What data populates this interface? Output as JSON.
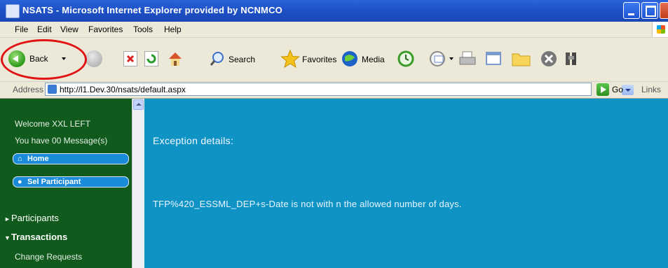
{
  "window": {
    "title": "NSATS - Microsoft Internet Explorer provided by NCNMCO"
  },
  "menu": {
    "items": [
      "File",
      "Edit",
      "View",
      "Favorites",
      "Tools",
      "Help"
    ]
  },
  "toolbar": {
    "back_label": "Back",
    "search_label": "Search",
    "favorites_label": "Favorites",
    "media_label": "Media"
  },
  "address_bar": {
    "label": "Address",
    "url": "http://l1.Dev.30/nsats/default.aspx",
    "go_label": "Go",
    "links_label": "Links"
  },
  "sidebar": {
    "welcome": "Welcome XXL LEFT",
    "messages": "You have 00 Message(s)",
    "buttons": [
      {
        "icon": "home-icon",
        "label": "Home"
      },
      {
        "icon": "participant-icon",
        "label": "Sel Participant"
      }
    ],
    "nav": [
      {
        "label": "Participants",
        "expanded": false
      },
      {
        "label": "Transactions",
        "expanded": true
      }
    ],
    "sub_items": [
      "Change Requests"
    ]
  },
  "main": {
    "exception_title": "Exception details:",
    "exception_message": "TFP%420_ESSML_DEP+s-Date is not with n the allowed number of days."
  },
  "colors": {
    "sidebar_bg": "#0f5a1c",
    "main_bg": "#0f93c5",
    "titlebar_bg": "#1f52c8",
    "highlight": "#e01414"
  }
}
